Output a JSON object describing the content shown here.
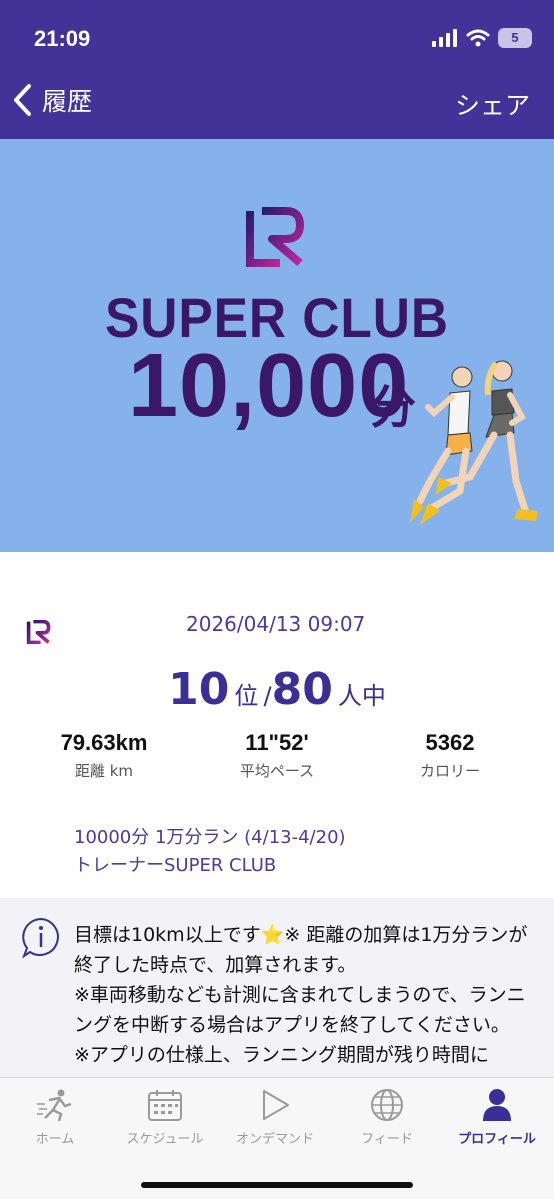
{
  "status_bar": {
    "time": "21:09",
    "battery": "5"
  },
  "nav": {
    "title": "履歴",
    "share_label": "シェア"
  },
  "banner": {
    "title": "SUPER CLUB",
    "number": "10,000",
    "unit": "分"
  },
  "summary": {
    "date": "2026/04/13 09:07",
    "rank": "10",
    "rank_unit": "位",
    "separator": "/",
    "total": "80",
    "total_unit": "人中",
    "stats": [
      {
        "value": "79.63km",
        "label": "距離 km"
      },
      {
        "value": "11\"52'",
        "label": "平均ペース"
      },
      {
        "value": "5362",
        "label": "カロリー"
      }
    ],
    "event_line1": "10000分 1万分ラン (4/13-4/20)",
    "event_line2": "トレーナーSUPER CLUB"
  },
  "info": {
    "line1": "目標は10km以上です",
    "star": "⭐",
    "line1b": "※ 距離の加算は1万分ランが終了した時点で、加算されます。",
    "line2": "※車両移動なども計測に含まれてしまうので、ランニングを中断する場合はアプリを終了してください。",
    "line3": "※アプリの仕様上、ランニング期間が残り時間に"
  },
  "tabs": [
    {
      "label": "ホーム",
      "icon": "runner-icon"
    },
    {
      "label": "スケジュール",
      "icon": "calendar-icon"
    },
    {
      "label": "オンデマンド",
      "icon": "play-icon"
    },
    {
      "label": "フィード",
      "icon": "globe-icon"
    },
    {
      "label": "プロフィール",
      "icon": "person-icon"
    }
  ],
  "colors": {
    "header": "#433399",
    "banner": "#86b2ec",
    "accent": "#3a2f96"
  }
}
